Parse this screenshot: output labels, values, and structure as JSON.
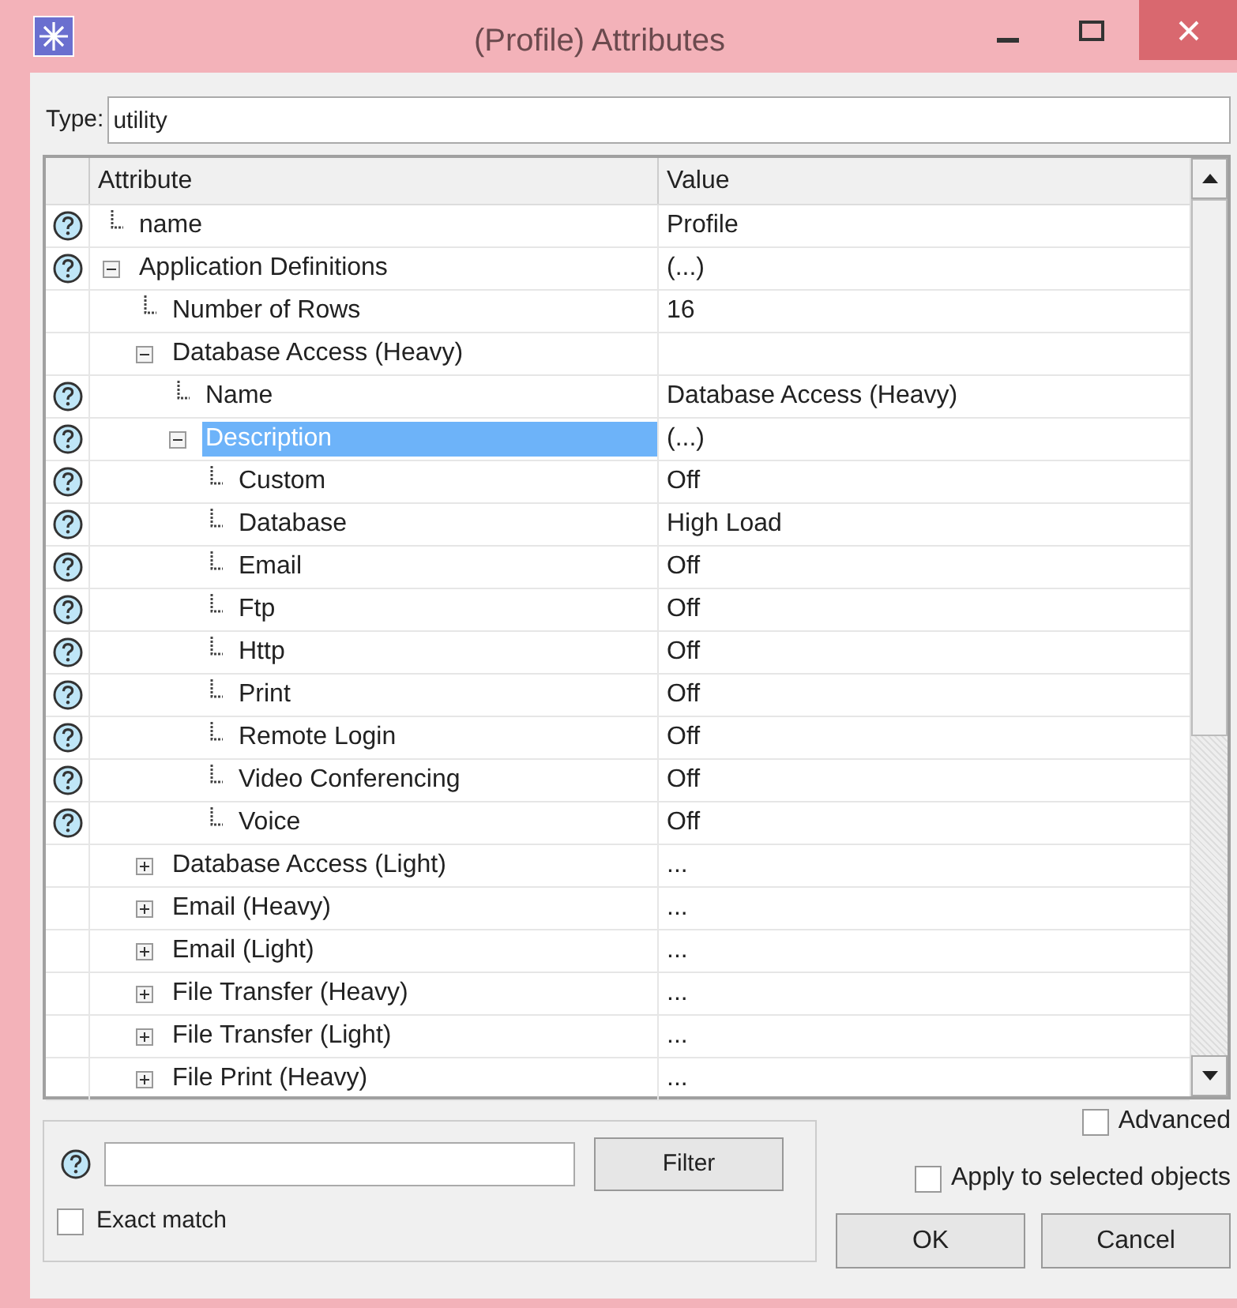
{
  "window": {
    "title": "(Profile) Attributes"
  },
  "type_field": {
    "label": "Type:",
    "value": "utility"
  },
  "table": {
    "columns": [
      "Attribute",
      "Value"
    ],
    "rows": [
      {
        "label": "name",
        "value": "Profile",
        "help": true,
        "selected": false
      },
      {
        "label": "Application Definitions",
        "value": "(...)",
        "help": true,
        "selected": false,
        "expanded": true,
        "children": [
          {
            "label": "Number of Rows",
            "value": "16",
            "help": false,
            "selected": false
          },
          {
            "label": "Database Access (Heavy)",
            "help": false,
            "selected": false,
            "expanded": true,
            "children": [
              {
                "label": "Name",
                "value": "Database Access (Heavy)",
                "help": true,
                "selected": false
              },
              {
                "label": "Description",
                "value": "(...)",
                "help": true,
                "selected": true,
                "expanded": true,
                "children": [
                  {
                    "label": "Custom",
                    "value": "Off",
                    "help": true,
                    "selected": false
                  },
                  {
                    "label": "Database",
                    "value": "High Load",
                    "help": true,
                    "selected": false
                  },
                  {
                    "label": "Email",
                    "value": "Off",
                    "help": true,
                    "selected": false
                  },
                  {
                    "label": "Ftp",
                    "value": "Off",
                    "help": true,
                    "selected": false
                  },
                  {
                    "label": "Http",
                    "value": "Off",
                    "help": true,
                    "selected": false
                  },
                  {
                    "label": "Print",
                    "value": "Off",
                    "help": true,
                    "selected": false
                  },
                  {
                    "label": "Remote Login",
                    "value": "Off",
                    "help": true,
                    "selected": false
                  },
                  {
                    "label": "Video Conferencing",
                    "value": "Off",
                    "help": true,
                    "selected": false
                  },
                  {
                    "label": "Voice",
                    "value": "Off",
                    "help": true,
                    "selected": false
                  }
                ]
              }
            ]
          },
          {
            "label": "Database Access (Light)",
            "value": "...",
            "help": false,
            "selected": false,
            "expanded": false
          },
          {
            "label": "Email (Heavy)",
            "value": "...",
            "help": false,
            "selected": false,
            "expanded": false
          },
          {
            "label": "Email (Light)",
            "value": "...",
            "help": false,
            "selected": false,
            "expanded": false
          },
          {
            "label": "File Transfer (Heavy)",
            "value": "...",
            "help": false,
            "selected": false,
            "expanded": false
          },
          {
            "label": "File Transfer (Light)",
            "value": "...",
            "help": false,
            "selected": false,
            "expanded": false
          },
          {
            "label": "File Print (Heavy)",
            "value": "...",
            "help": false,
            "selected": false,
            "expanded": false
          }
        ]
      }
    ]
  },
  "filter": {
    "button": "Filter",
    "exact_match": {
      "label": "Exact match",
      "checked": false
    }
  },
  "advanced": {
    "label": "Advanced",
    "checked": false
  },
  "apply_selected": {
    "label": "Apply to selected objects",
    "checked": false
  },
  "buttons": [
    "OK",
    "Cancel"
  ]
}
